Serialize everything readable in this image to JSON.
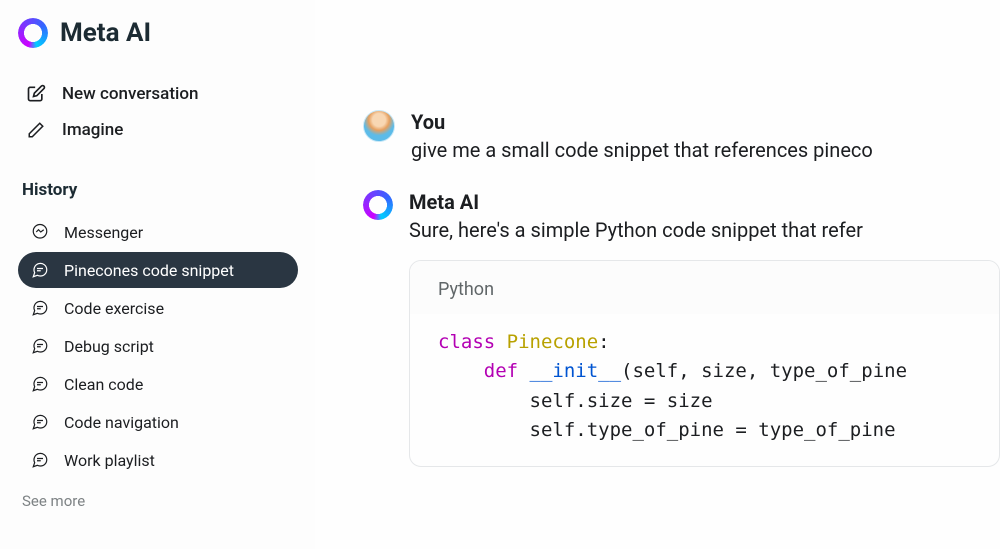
{
  "brand": {
    "title": "Meta AI"
  },
  "actions": {
    "new_conversation": "New conversation",
    "imagine": "Imagine"
  },
  "history": {
    "label": "History",
    "items": [
      {
        "label": "Messenger",
        "icon": "messenger"
      },
      {
        "label": "Pinecones code snippet",
        "icon": "thread",
        "active": true
      },
      {
        "label": "Code exercise",
        "icon": "thread"
      },
      {
        "label": "Debug script",
        "icon": "thread"
      },
      {
        "label": "Clean code",
        "icon": "thread"
      },
      {
        "label": "Code navigation",
        "icon": "thread"
      },
      {
        "label": "Work playlist",
        "icon": "thread"
      }
    ],
    "see_more": "See more"
  },
  "conversation": {
    "user": {
      "author": "You",
      "text": "give me a small code snippet that references pineco"
    },
    "assistant": {
      "author": "Meta AI",
      "text": "Sure, here's a simple Python code snippet that refer",
      "code_lang": "Python",
      "code": {
        "l1_kw": "class",
        "l1_cls": " Pinecone",
        "l1_rest": ":",
        "l2_kw": "    def",
        "l2_fn": " __init__",
        "l2_rest": "(self, size, type_of_pine",
        "l3": "        self.size = size",
        "l4": "        self.type_of_pine = type_of_pine"
      }
    }
  }
}
